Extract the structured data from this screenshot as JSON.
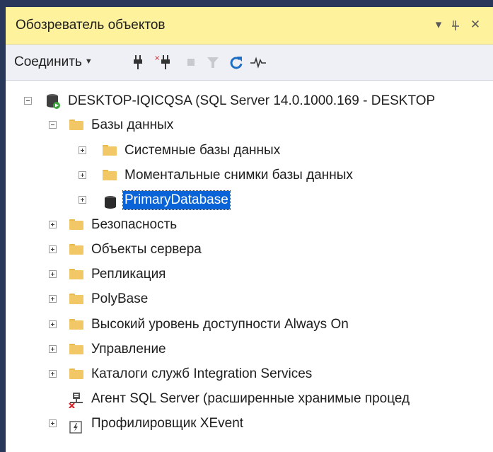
{
  "panel": {
    "title": "Обозреватель объектов",
    "pin_glyph": "▾ ꟼ",
    "close_glyph": "✕"
  },
  "toolbar": {
    "connect_label": "Соединить",
    "icons": [
      "connect-plug-icon",
      "disconnect-plug-icon",
      "stop-icon",
      "filter-icon",
      "refresh-icon",
      "activity-monitor-icon"
    ]
  },
  "tree": {
    "server": "DESKTOP-IQICQSA (SQL Server 14.0.1000.169 - DESKTOP",
    "databases": "Базы данных",
    "system_databases": "Системные базы данных",
    "snapshots": "Моментальные снимки базы данных",
    "primary_db": "PrimaryDatabase",
    "security": "Безопасность",
    "server_objects": "Объекты сервера",
    "replication": "Репликация",
    "polybase": "PolyBase",
    "always_on": "Высокий уровень доступности Always On",
    "management": "Управление",
    "integration_services": "Каталоги служб Integration Services",
    "sql_agent": "Агент SQL Server (расширенные хранимые процед",
    "xevent": "Профилировщик XEvent"
  },
  "colors": {
    "titlebar_bg": "#fff29d",
    "selection": "#0a64d8",
    "frame": "#29375a"
  }
}
